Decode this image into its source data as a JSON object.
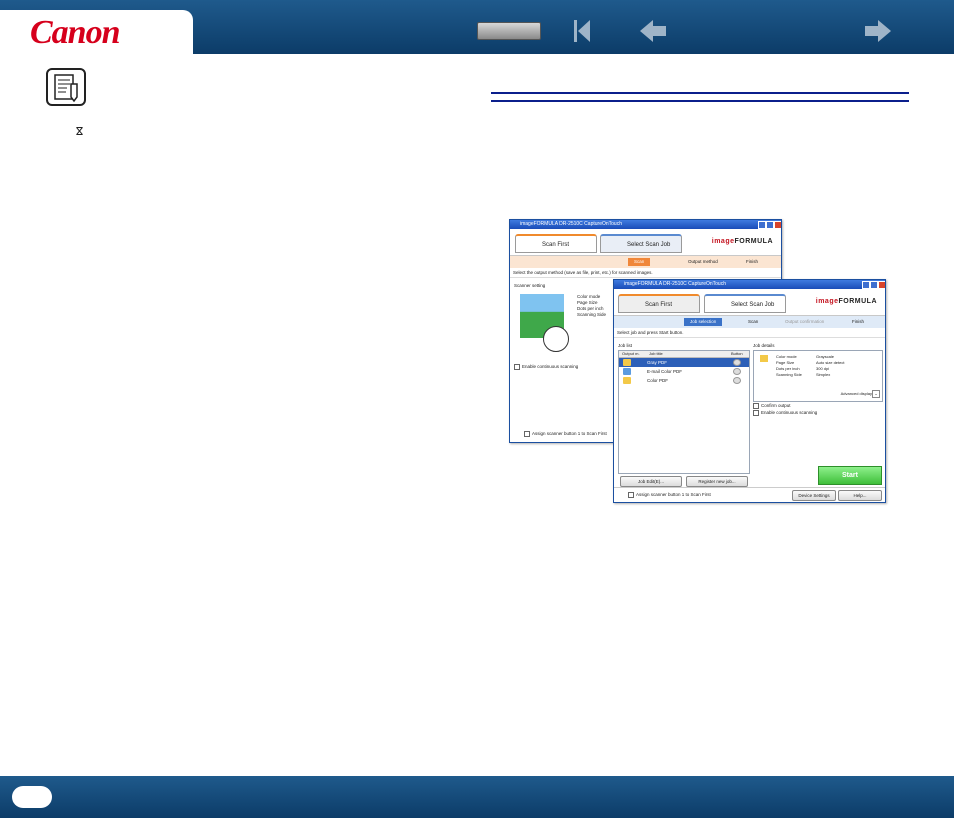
{
  "header": {
    "logo": "Canon",
    "nav_icons": [
      "toc-button",
      "first-page-icon",
      "prev-page-icon",
      "next-page-icon"
    ]
  },
  "note": {
    "icon": "note-icon",
    "mark": "ⴵ"
  },
  "back_window": {
    "title": "imageFORMULA DR-2510C CaptureOnTouch",
    "tab_active": "Scan First",
    "tab_inactive": "Select Scan Job",
    "brand_prefix": "image",
    "brand_suffix": "FORMULA",
    "steps": [
      "Scan",
      "Output method",
      "Finish"
    ],
    "instruction": "Select the output method (save as file, print, etc.) for scanned images.",
    "scanner_setting_label": "Scanner setting",
    "settings": [
      "Color mode",
      "Page Size",
      "Dots per inch",
      "Scanning Side"
    ],
    "continuous": "Enable continuous scanning",
    "assign": "Assign scanner button 1 to Scan First"
  },
  "front_window": {
    "title": "imageFORMULA DR-2510C CaptureOnTouch",
    "tab_inactive": "Scan First",
    "tab_active": "Select Scan Job",
    "brand_prefix": "image",
    "brand_suffix": "FORMULA",
    "steps": [
      "Job selection",
      "Scan",
      "Output confirmation",
      "Finish"
    ],
    "instruction": "Select job and press Start button.",
    "job_list_label": "Job list",
    "columns": [
      "Output m.",
      "Job title",
      "Button"
    ],
    "jobs": [
      "Gray PDF",
      "E-mail Color PDF",
      "Color PDF"
    ],
    "job_details_label": "Job details",
    "detail_keys": [
      "Color mode",
      "Page Size",
      "Dots per inch",
      "Scanning Side"
    ],
    "detail_vals": [
      "Grayscale",
      "Auto size detect",
      "300 dpi",
      "Simplex"
    ],
    "advanced": "Advanced display",
    "confirm": "Confirm output",
    "continuous": "Enable continuous scanning",
    "start": "Start",
    "job_edit": "Job Edit(E)...",
    "register": "Register new job...",
    "assign": "Assign scanner button 1 to Scan First",
    "device_settings": "Device Settings",
    "help": "Help..."
  },
  "colors": {
    "brand_red": "#d6001c",
    "bar_blue": "#0c3c68",
    "rule_blue": "#0b1f8c"
  }
}
